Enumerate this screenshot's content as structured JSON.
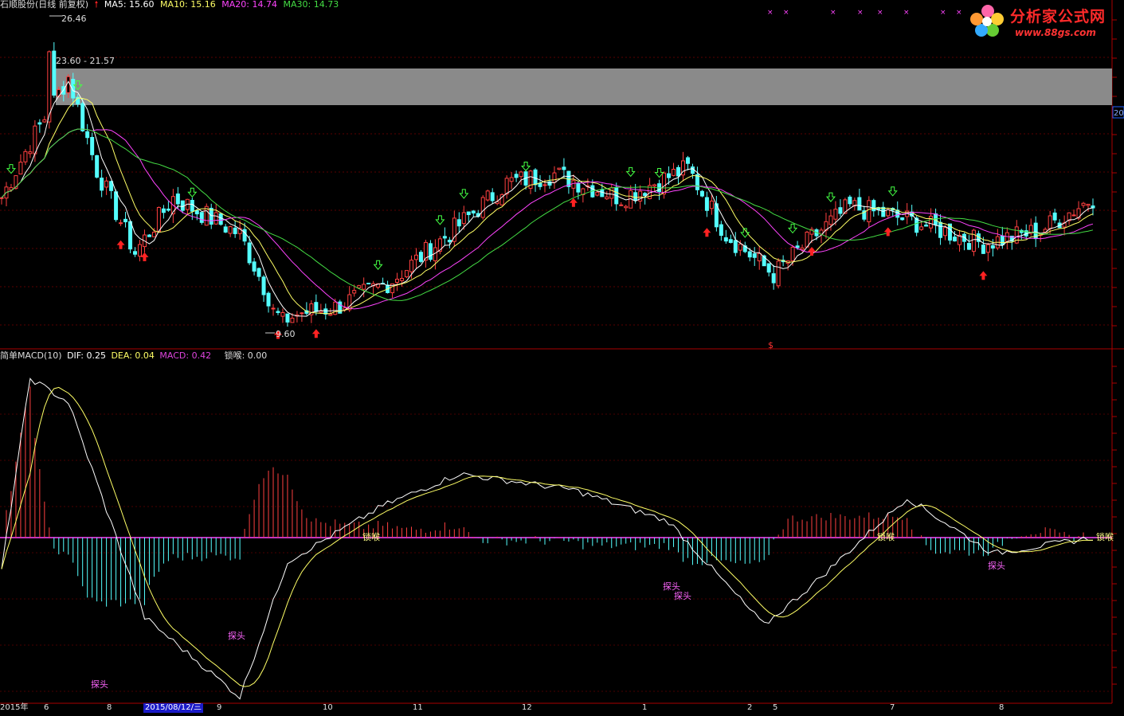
{
  "header": {
    "title": "石顺股份(日线 前复权)",
    "ma5": "MA5: 15.60",
    "ma10": "MA10: 15.16",
    "ma20": "MA20: 14.74",
    "ma30": "MA30: 14.73",
    "ma5_color": "#ffffff",
    "ma10_color": "#ffff66",
    "ma20_color": "#ff44ff",
    "ma30_color": "#44dd44"
  },
  "price_labels": {
    "high": "26.46",
    "zone": "23.60 - 21.57",
    "low": "9.60"
  },
  "right_axis_value": "20",
  "indicator": {
    "name": "简单MACD(10)",
    "dif": "DIF: 0.25",
    "dea": "DEA: 0.04",
    "macd": "MACD: 0.42",
    "lock": "锁喉: 0.00",
    "macd_color": "#dd44dd",
    "dif_color": "#ffffff",
    "dea_color": "#ffff66"
  },
  "annotations": {
    "lock_label": "锁喉",
    "head_label": "探头"
  },
  "watermark": {
    "brand": "分析家公式网",
    "url": "www.88gs.com"
  },
  "date_axis": {
    "labels": [
      "2015年",
      "6",
      "8",
      "2015/08/12/三",
      "9",
      "10",
      "11",
      "12",
      "1",
      "2",
      "5",
      "7",
      "8"
    ]
  },
  "chart_data": {
    "type": "candlestick",
    "title": "石顺股份(日线 前复权)",
    "y_high": 26.46,
    "y_low": 9.6,
    "resistance_zone": [
      21.57,
      23.6
    ],
    "moving_averages": {
      "MA5": 15.6,
      "MA10": 15.16,
      "MA20": 14.74,
      "MA30": 14.73
    },
    "macd_indicator": {
      "DIF": 0.25,
      "DEA": 0.04,
      "MACD": 0.42,
      "锁喉": 0.0
    }
  }
}
